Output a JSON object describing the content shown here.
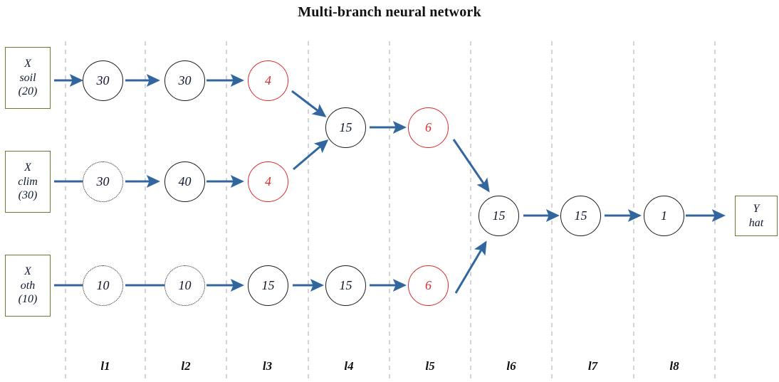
{
  "title": "Multi-branch neural network",
  "colors": {
    "arrow_blue": "#31679e",
    "red_node": "#dd2b2b",
    "box_border": "#74742b",
    "separator": "#c9c9c9",
    "text": "#101830"
  },
  "inputs": [
    {
      "var": "X",
      "sub": "soil",
      "dim": "(20)"
    },
    {
      "var": "X",
      "sub": "clim",
      "dim": "(30)"
    },
    {
      "var": "X",
      "sub": "oth",
      "dim": "(10)"
    }
  ],
  "output": {
    "var": "Y",
    "sub": "hat"
  },
  "layer_labels": [
    "l1",
    "l2",
    "l3",
    "l4",
    "l5",
    "l6",
    "l7",
    "l8"
  ],
  "branches": [
    {
      "name": "soil-branch",
      "nodes": [
        {
          "label": "30",
          "style": "solid",
          "layer": "l1"
        },
        {
          "label": "30",
          "style": "solid",
          "layer": "l2"
        },
        {
          "label": "4",
          "style": "red",
          "layer": "l3"
        }
      ]
    },
    {
      "name": "clim-branch",
      "nodes": [
        {
          "label": "30",
          "style": "dotted",
          "layer": "l1"
        },
        {
          "label": "40",
          "style": "solid",
          "layer": "l2"
        },
        {
          "label": "4",
          "style": "red",
          "layer": "l3"
        }
      ]
    },
    {
      "name": "oth-branch",
      "nodes": [
        {
          "label": "10",
          "style": "dotted",
          "layer": "l1"
        },
        {
          "label": "10",
          "style": "dotted",
          "layer": "l2"
        },
        {
          "label": "15",
          "style": "solid",
          "layer": "l3"
        },
        {
          "label": "15",
          "style": "solid",
          "layer": "l4"
        },
        {
          "label": "6",
          "style": "red",
          "layer": "l5"
        }
      ]
    }
  ],
  "merge_upper": [
    {
      "label": "15",
      "style": "solid",
      "layer": "l4"
    },
    {
      "label": "6",
      "style": "red",
      "layer": "l5"
    }
  ],
  "trunk": [
    {
      "label": "15",
      "style": "solid",
      "layer": "l6"
    },
    {
      "label": "15",
      "style": "solid",
      "layer": "l7"
    },
    {
      "label": "1",
      "style": "solid",
      "layer": "l8"
    }
  ]
}
